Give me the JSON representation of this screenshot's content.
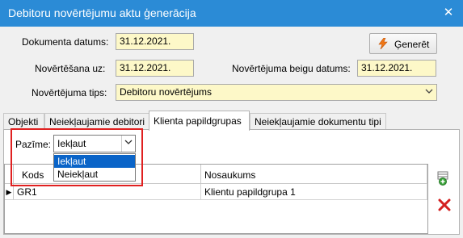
{
  "window": {
    "title": "Debitoru novērtējumu aktu ģenerācija",
    "close_glyph": "✕"
  },
  "form": {
    "dokumenta_datums": {
      "label": "Dokumenta datums:",
      "value": "31.12.2021."
    },
    "novertesana_uz": {
      "label": "Novērtēšana uz:",
      "value": "31.12.2021."
    },
    "beigu_datums": {
      "label": "Novērtējuma beigu datums:",
      "value": "31.12.2021."
    },
    "tips": {
      "label": "Novērtējuma tips:",
      "value": "Debitoru novērtējums"
    }
  },
  "generate_button": {
    "label": "Ģenerēt",
    "icon": "lightning-icon"
  },
  "tabs": [
    {
      "label": "Objekti"
    },
    {
      "label": "Neiekļaujamie debitori"
    },
    {
      "label": "Klienta papildgrupas"
    },
    {
      "label": "Neiekļaujamie dokumentu tipi"
    }
  ],
  "active_tab": "Klienta papildgrupas",
  "filter": {
    "label": "Pazīme:",
    "value": "Iekļaut",
    "options": [
      "Iekļaut",
      "Neiekļaut"
    ],
    "highlighted_option": "Iekļaut"
  },
  "grid": {
    "columns": [
      "Kods",
      "Nosaukums"
    ],
    "rows": [
      {
        "kods": "GR1",
        "nosaukums": "Klientu papildgrupa 1"
      }
    ]
  },
  "side_actions": [
    {
      "icon": "add-record-icon"
    },
    {
      "icon": "delete-icon"
    }
  ],
  "colors": {
    "titlebar": "#2b8bd6",
    "field_bg": "#fdf8c8",
    "highlight": "#e02020",
    "selection": "#0a64c8"
  }
}
